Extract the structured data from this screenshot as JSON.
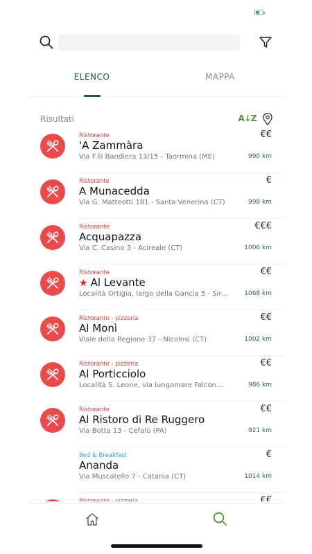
{
  "status_bar": {
    "battery_level": 0.6,
    "battery_color": "#3ab54a"
  },
  "search": {
    "placeholder": "",
    "value": ""
  },
  "tabs": [
    {
      "label": "ELENCO",
      "active": true
    },
    {
      "label": "MAPPA",
      "active": false
    }
  ],
  "results": {
    "label": "Risultati",
    "sort_label": "A↓Z"
  },
  "colors": {
    "accent": "#1e5c35",
    "sort": "#4a9a2f",
    "avatar": "#ec4a4a",
    "category_restaurant": "#d9413f",
    "category_bb": "#2aa0c8"
  },
  "items": [
    {
      "category": "Ristorante",
      "name": "'A Zammàra",
      "address": "Via F.lli Bandiera 13/15 - Taormina (ME)",
      "price": "€€",
      "distance": "990 km",
      "icon": "fork-spoon-icon",
      "star": false
    },
    {
      "category": "Ristorante",
      "name": "A Munacedda",
      "address": "Via G. Matteotti 181 - Santa Venerina (CT)",
      "price": "€",
      "distance": "998 km",
      "icon": "fork-spoon-icon",
      "star": false
    },
    {
      "category": "Ristorante",
      "name": "Acquapazza",
      "address": "Via C. Casino 3 - Acireale (CT)",
      "price": "€€€",
      "distance": "1006 km",
      "icon": "fork-spoon-icon",
      "star": false
    },
    {
      "category": "Ristorante",
      "name": "Al Levante",
      "address": "Località Ortigia, largo della Gancia 5 - Sir…",
      "price": "€€",
      "distance": "1068 km",
      "icon": "fork-spoon-icon",
      "star": true
    },
    {
      "category": "Ristorante - pizzeria",
      "name": "Al Monì",
      "address": "Viale della Regione 37 - Nicolosi (CT)",
      "price": "€€",
      "distance": "1002 km",
      "icon": "fork-spoon-icon",
      "star": false
    },
    {
      "category": "Ristorante - pizzeria",
      "name": "Al Porticciolo",
      "address": "Località S. Leone, via lungomare Falcon…",
      "price": "€€",
      "distance": "986 km",
      "icon": "fork-spoon-icon",
      "star": false
    },
    {
      "category": "Ristorante",
      "name": "Al Ristoro di Re Ruggero",
      "address": "Via Botta 13 - Cefalù (PA)",
      "price": "€€",
      "distance": "921 km",
      "icon": "fork-spoon-icon",
      "star": false
    },
    {
      "category": "Bed & Breakfast",
      "name": "Ananda",
      "address": "Via Muscatello 7 - Catania (CT)",
      "price": "€",
      "distance": "1014 km",
      "icon": "",
      "star": false
    },
    {
      "category": "Ristorante - pizzeria",
      "name": "",
      "address": "",
      "price": "€€",
      "distance": "",
      "icon": "fork-spoon-icon",
      "star": false
    }
  ],
  "bottom_nav": [
    {
      "icon": "home-icon",
      "active": false
    },
    {
      "icon": "search-icon",
      "active": true
    }
  ]
}
